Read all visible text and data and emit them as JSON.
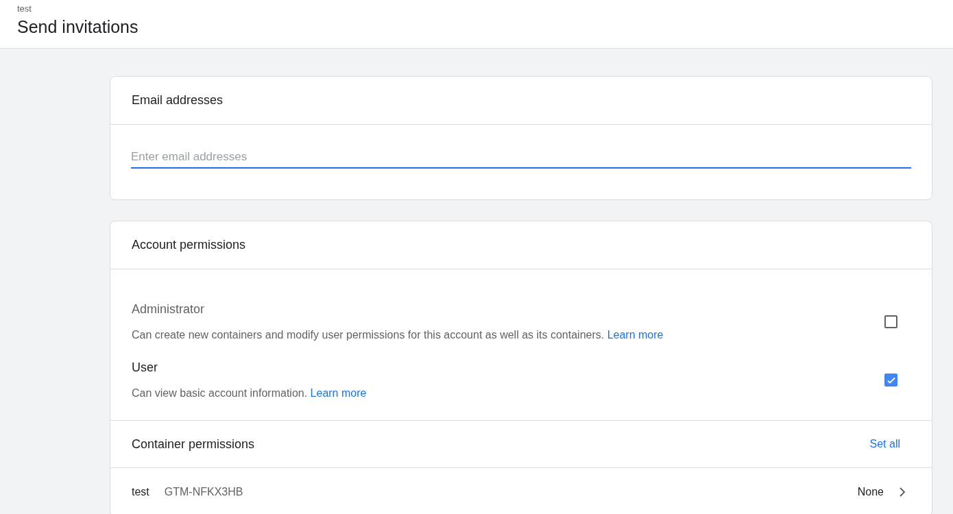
{
  "header": {
    "breadcrumb": "test",
    "title": "Send invitations"
  },
  "email_card": {
    "title": "Email addresses",
    "field": {
      "placeholder": "Enter email addresses",
      "focused": true
    }
  },
  "permissions_card": {
    "title": "Account permissions",
    "roles": [
      {
        "name": "Administrator",
        "description": "Can create new containers and modify user permissions for this account as well as its containers.",
        "link": "Learn more",
        "checked": false
      },
      {
        "name": "User",
        "description": "Can view basic account information.",
        "link": "Learn more",
        "checked": true
      }
    ],
    "container_section": {
      "title": "Container permissions",
      "action": "Set all",
      "rows": [
        {
          "name": "test",
          "id": "GTM-NFKX3HB",
          "permission": "None"
        }
      ]
    }
  }
}
